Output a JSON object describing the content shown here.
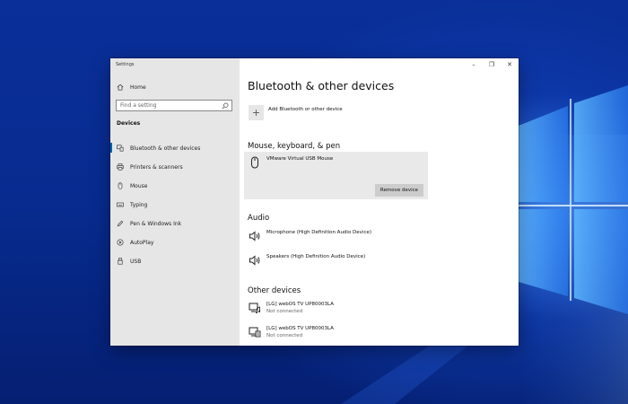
{
  "window": {
    "app_title": "Settings",
    "controls": {
      "minimize": "–",
      "restore": "❐",
      "close": "✕"
    }
  },
  "sidebar": {
    "home_label": "Home",
    "search_placeholder": "Find a setting",
    "section_title": "Devices",
    "items": [
      {
        "label": "Bluetooth & other devices",
        "icon": "bluetooth-devices-icon",
        "active": true
      },
      {
        "label": "Printers & scanners",
        "icon": "printer-icon",
        "active": false
      },
      {
        "label": "Mouse",
        "icon": "mouse-icon",
        "active": false
      },
      {
        "label": "Typing",
        "icon": "keyboard-icon",
        "active": false
      },
      {
        "label": "Pen & Windows Ink",
        "icon": "pen-icon",
        "active": false
      },
      {
        "label": "AutoPlay",
        "icon": "autoplay-icon",
        "active": false
      },
      {
        "label": "USB",
        "icon": "usb-icon",
        "active": false
      }
    ]
  },
  "main": {
    "title": "Bluetooth & other devices",
    "add_device_label": "Add Bluetooth or other device",
    "groups": {
      "input": {
        "title": "Mouse, keyboard, & pen",
        "devices": [
          {
            "name": "VMware Virtual USB Mouse"
          }
        ],
        "remove_button": "Remove device"
      },
      "audio": {
        "title": "Audio",
        "devices": [
          {
            "name": "Microphone (High Definition Audio Device)"
          },
          {
            "name": "Speakers (High Definition Audio Device)"
          }
        ]
      },
      "other": {
        "title": "Other devices",
        "devices": [
          {
            "name": "[LG] webOS TV UP80003LA",
            "status": "Not connected"
          },
          {
            "name": "[LG] webOS TV UP80003LA",
            "status": "Not connected"
          }
        ]
      }
    }
  },
  "colors": {
    "accent": "#0063b1",
    "sidebar_bg": "#e6e6e6",
    "desktop_bg": "#0a2f99"
  }
}
